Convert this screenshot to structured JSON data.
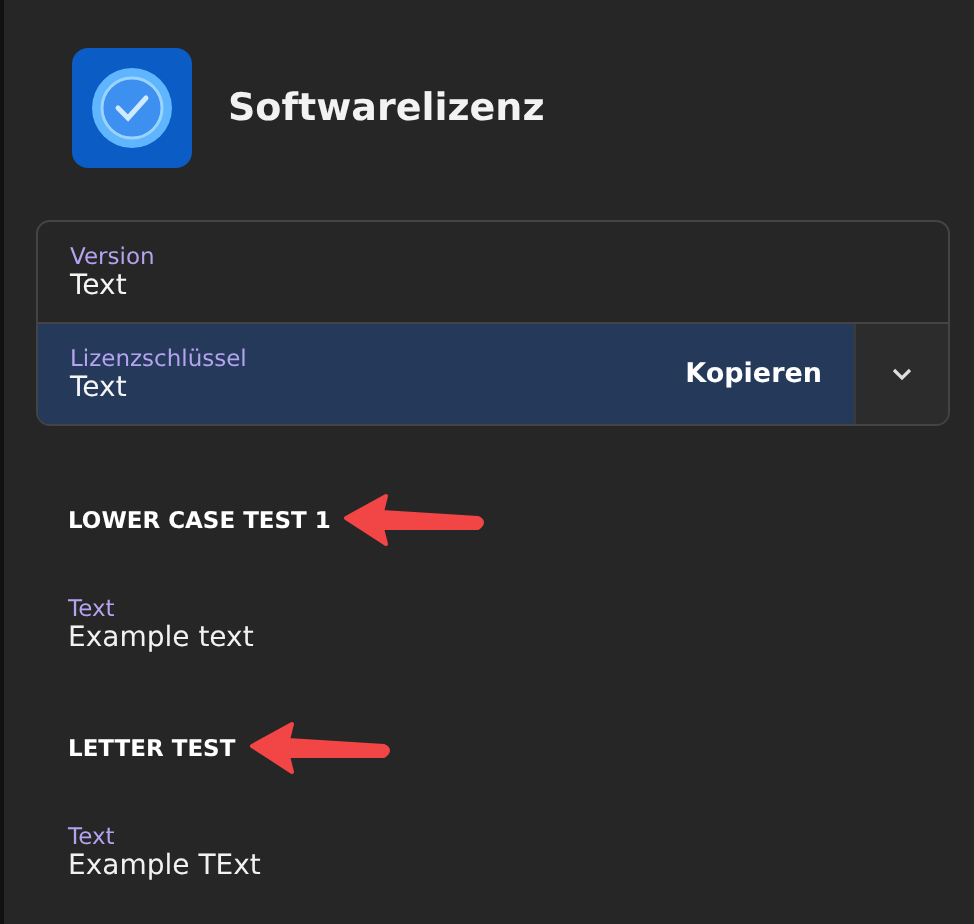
{
  "header": {
    "title": "Softwarelizenz"
  },
  "fields": [
    {
      "label": "Version",
      "value": "Text",
      "selected": false
    },
    {
      "label": "Lizenzschlüssel",
      "value": "Text",
      "selected": true,
      "action": "Kopieren"
    }
  ],
  "sections": [
    {
      "heading": "LOWER CASE TEST 1",
      "label": "Text",
      "value": "Example text"
    },
    {
      "heading": "LETTER TEST",
      "label": "Text",
      "value": "Example TExt"
    }
  ]
}
